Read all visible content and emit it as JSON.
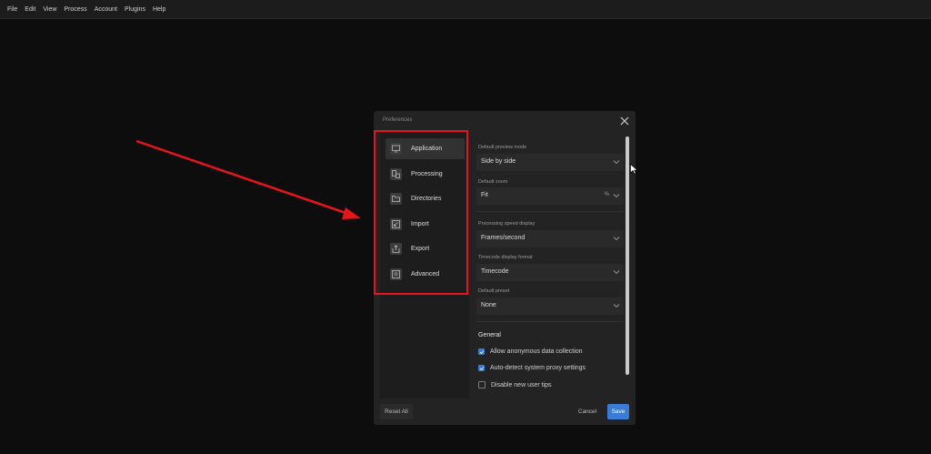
{
  "menubar": {
    "items": [
      "File",
      "Edit",
      "View",
      "Process",
      "Account",
      "Plugins",
      "Help"
    ]
  },
  "dialog": {
    "title": "Preferences",
    "sidebar": {
      "items": [
        {
          "label": "Application",
          "icon": "monitor-icon",
          "active": true
        },
        {
          "label": "Processing",
          "icon": "processing-icon",
          "active": false
        },
        {
          "label": "Directories",
          "icon": "folder-icon",
          "active": false
        },
        {
          "label": "Import",
          "icon": "import-icon",
          "active": false
        },
        {
          "label": "Export",
          "icon": "export-icon",
          "active": false
        },
        {
          "label": "Advanced",
          "icon": "advanced-icon",
          "active": false
        }
      ]
    },
    "settings": {
      "preview_mode": {
        "label": "Default preview mode",
        "value": "Side by side"
      },
      "zoom": {
        "label": "Default zoom",
        "value": "Fit",
        "unit": "%"
      },
      "speed_display": {
        "label": "Processing speed display",
        "value": "Frames/second"
      },
      "timecode": {
        "label": "Timecode display format",
        "value": "Timecode"
      },
      "preset": {
        "label": "Default preset",
        "value": "None"
      }
    },
    "general": {
      "title": "General",
      "options": [
        {
          "label": "Allow anonymous data collection",
          "checked": true
        },
        {
          "label": "Auto-detect system proxy settings",
          "checked": true
        },
        {
          "label": "Disable new user tips",
          "checked": false
        }
      ]
    },
    "buttons": {
      "reset": "Reset All",
      "cancel": "Cancel",
      "save": "Save"
    }
  },
  "colors": {
    "accent": "#3a7bd5",
    "highlight": "#e8141b",
    "background": "#0d0d0d",
    "dialog": "#232323"
  }
}
